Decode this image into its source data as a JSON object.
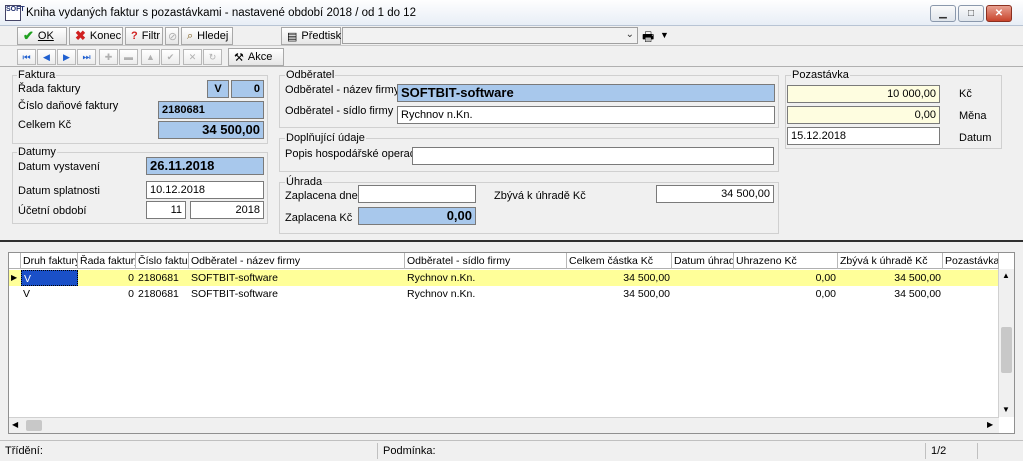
{
  "window": {
    "title": "Kniha vydaných faktur s pozastávkami - nastavené období 2018 / od 1 do 12",
    "app_icon_text": "SOFT",
    "minimize": "▁",
    "maximize": "□",
    "close": "✕"
  },
  "toolbar": {
    "ok_label": "OK",
    "konec_label": "Konec",
    "filtr_label": "Filtr",
    "hledej_label": "Hledej",
    "predtisk_label": "Předtisk",
    "akce_label": "Akce",
    "combo_value": ""
  },
  "faktura": {
    "legend": "Faktura",
    "rada_label": "Řada faktury",
    "rada_type": "V",
    "rada_num": "0",
    "cislo_label": "Číslo daňové faktury",
    "cislo_value": "2180681",
    "celkem_label": "Celkem Kč",
    "celkem_value": "34 500,00"
  },
  "datumy": {
    "legend": "Datumy",
    "vystaveni_label": "Datum vystavení",
    "vystaveni_value": "26.11.2018",
    "splatnosti_label": "Datum splatnosti",
    "splatnosti_value": "10.12.2018",
    "obdobi_label": "Účetní období",
    "obdobi_month": "11",
    "obdobi_year": "2018"
  },
  "odberatel": {
    "legend": "Odběratel",
    "nazev_label": "Odběratel - název firmy",
    "nazev_value": "SOFTBIT-software",
    "sidlo_label": "Odběratel - sídlo firmy",
    "sidlo_value": "Rychnov n.Kn."
  },
  "doplnujici": {
    "legend": "Doplňující údaje",
    "popis_label": "Popis hospodářské operace",
    "popis_value": ""
  },
  "uhrada": {
    "legend": "Úhrada",
    "zaplacena_dne_label": "Zaplacena dne",
    "zaplacena_dne_value": "",
    "zaplacena_kc_label": "Zaplacena Kč",
    "zaplacena_kc_value": "0,00",
    "zbyva_label": "Zbývá k úhradě Kč",
    "zbyva_value": "34 500,00"
  },
  "pozastavka": {
    "legend": "Pozastávka",
    "kc_value": "10 000,00",
    "kc_label": "Kč",
    "mena_value": "0,00",
    "mena_label": "Měna",
    "datum_value": "15.12.2018",
    "datum_label": "Datum"
  },
  "grid": {
    "columns": [
      "Druh faktury",
      "Řada faktury",
      "Číslo faktury",
      "Odběratel - název firmy",
      "Odběratel - sídlo firmy",
      "Celkem částka Kč",
      "Datum úhrady",
      "Uhrazeno Kč",
      "Zbývá k úhradě Kč",
      "Pozastávka"
    ],
    "rows": [
      [
        "V",
        "0",
        "2180681",
        "SOFTBIT-software",
        "Rychnov n.Kn.",
        "34 500,00",
        "",
        "0,00",
        "34 500,00",
        ""
      ],
      [
        "V",
        "0",
        "2180681",
        "SOFTBIT-software",
        "Rychnov n.Kn.",
        "34 500,00",
        "",
        "0,00",
        "34 500,00",
        ""
      ]
    ],
    "selected_row_color": "#ffff99"
  },
  "status": {
    "trideni_label": "Třídění:",
    "podminka_label": "Podmínka:",
    "records": "1/2"
  }
}
